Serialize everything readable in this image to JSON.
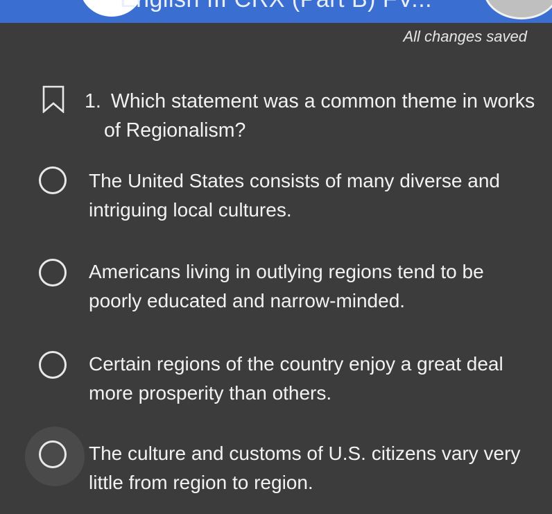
{
  "header": {
    "title": "English III CRX (Part B) FV..."
  },
  "status": {
    "saved_text": "All changes saved"
  },
  "question": {
    "number": "1.",
    "text_line1": "Which statement was a common theme in works",
    "text_line2": "of Regionalism?"
  },
  "options": [
    {
      "line1": "The United States consists of many diverse and",
      "line2": "intriguing local cultures."
    },
    {
      "line1": "Americans living in outlying regions tend to be",
      "line2": "poorly educated and narrow-minded."
    },
    {
      "line1": "Certain regions of the country enjoy a great deal",
      "line2": "more prosperity than others."
    },
    {
      "line1": "The culture and customs of U.S. citizens vary very",
      "line2": "little from region to region."
    }
  ],
  "colors": {
    "header_bg": "#3a6fd1",
    "page_bg": "#3c3c3c",
    "text": "#f2f2f2"
  }
}
